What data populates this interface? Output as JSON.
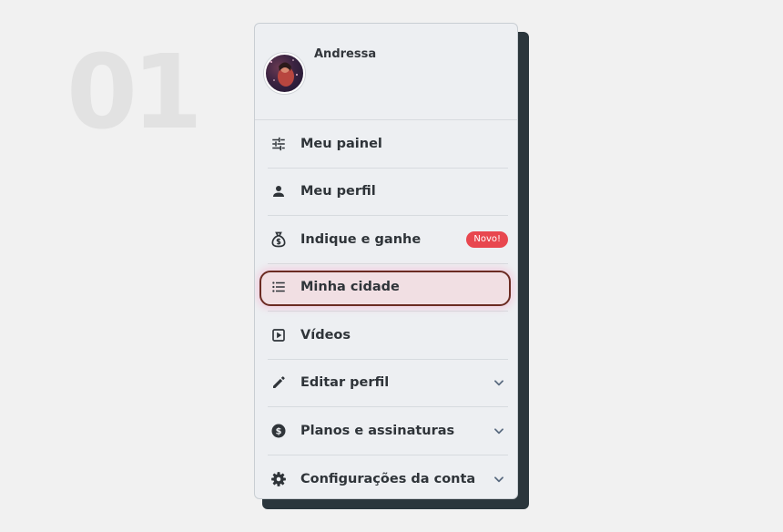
{
  "step": {
    "number": "01"
  },
  "user": {
    "name": "Andressa"
  },
  "menu": {
    "items": [
      {
        "label": "Meu painel",
        "icon": "sliders-icon"
      },
      {
        "label": "Meu perfil",
        "icon": "person-icon"
      },
      {
        "label": "Indique e ganhe",
        "icon": "money-bag-icon",
        "badge": "Novo!"
      },
      {
        "label": "Minha cidade",
        "icon": "list-icon",
        "highlighted": true
      },
      {
        "label": "Vídeos",
        "icon": "play-square-icon"
      },
      {
        "label": "Editar perfil",
        "icon": "pencil-icon",
        "expandable": true
      },
      {
        "label": "Planos e assinaturas",
        "icon": "dollar-circle-icon",
        "expandable": true
      },
      {
        "label": "Configurações da conta",
        "icon": "gear-icon",
        "expandable": true
      }
    ]
  },
  "colors": {
    "background": "#f1f1f1",
    "card": "#edeff2",
    "card_shadow": "#2b363c",
    "badge": "#e8474f",
    "highlight_border": "#6b2b22",
    "highlight_fill": "#f1dfe3",
    "text": "#2f3439"
  }
}
